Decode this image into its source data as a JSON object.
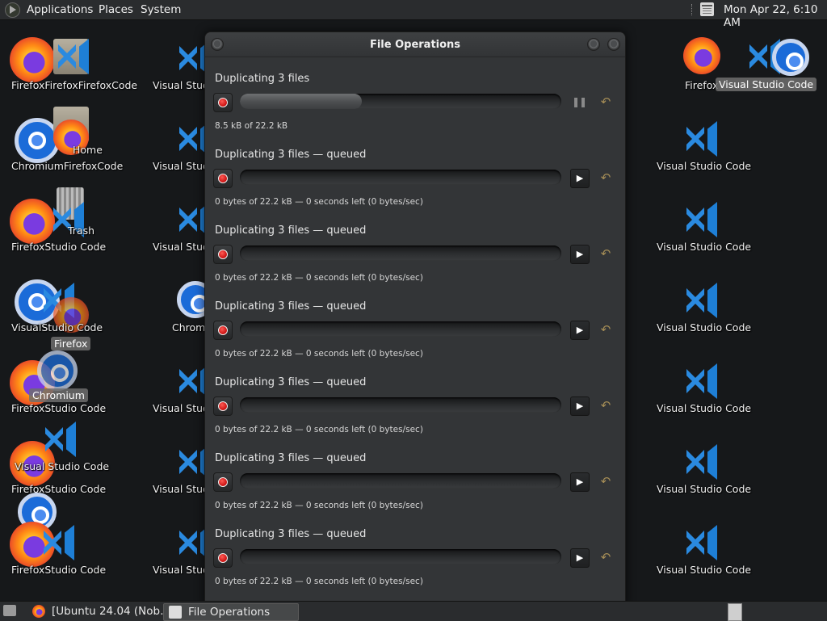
{
  "top_panel": {
    "menus": [
      "Applications",
      "Places",
      "System"
    ],
    "clock": "Mon Apr 22,  6:10 AM"
  },
  "desktop": {
    "icon_labels": {
      "col1_r1": "FirefoxFirefoxFirefoxCode",
      "col1_r2": "ChromiumFirefoxCode",
      "col1_r3": "FirefoxStudio Code",
      "col1_r4": "VisualStudio Code",
      "col1_r5": "FirefoxStudio Code",
      "col1_r6a": "Visual Studio Code",
      "col1_r6b": "FirefoxStudio Code",
      "col1_r7": "FirefoxStudio Code",
      "home": "Home",
      "trash": "Trash",
      "firefox_drag": "Firefox",
      "chromium_drag": "Chromium",
      "col2_vscode": "Visual Studio Code",
      "col2_chromium": "Chromium",
      "col4_firefox": "Firefox",
      "col4_hover": "Visual Studio Code",
      "col4_vscode": "Visual Studio Code"
    }
  },
  "window": {
    "title": "File Operations",
    "operations": [
      {
        "title": "Duplicating 3 files",
        "status": "8.5 kB of 22.2 kB",
        "progress": 0.38,
        "state": "running"
      },
      {
        "title": "Duplicating 3 files — queued",
        "status": "0 bytes of 22.2 kB — 0 seconds left (0 bytes/sec)",
        "progress": 0,
        "state": "queued"
      },
      {
        "title": "Duplicating 3 files — queued",
        "status": "0 bytes of 22.2 kB — 0 seconds left (0 bytes/sec)",
        "progress": 0,
        "state": "queued"
      },
      {
        "title": "Duplicating 3 files — queued",
        "status": "0 bytes of 22.2 kB — 0 seconds left (0 bytes/sec)",
        "progress": 0,
        "state": "queued"
      },
      {
        "title": "Duplicating 3 files — queued",
        "status": "0 bytes of 22.2 kB — 0 seconds left (0 bytes/sec)",
        "progress": 0,
        "state": "queued"
      },
      {
        "title": "Duplicating 3 files — queued",
        "status": "0 bytes of 22.2 kB — 0 seconds left (0 bytes/sec)",
        "progress": 0,
        "state": "queued"
      },
      {
        "title": "Duplicating 3 files — queued",
        "status": "0 bytes of 22.2 kB — 0 seconds left (0 bytes/sec)",
        "progress": 0,
        "state": "queued"
      }
    ]
  },
  "taskbar": {
    "tasks": [
      {
        "label": "[Ubuntu 24.04 (Nob…",
        "icon": "firefox-icon"
      },
      {
        "label": "File Operations",
        "icon": "file-manager-icon"
      }
    ]
  },
  "colors": {
    "stop_red": "#d61818",
    "undo_gold": "#a58d56",
    "panel": "#2a2c2e"
  }
}
